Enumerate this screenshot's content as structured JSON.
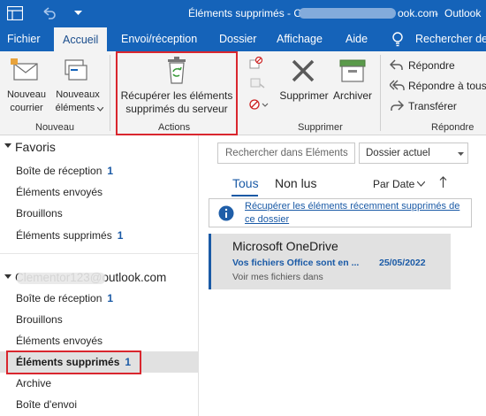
{
  "titlebar": {
    "title": "Éléments supprimés - C",
    "email_suffix": "ook.com",
    "app": "Outlook"
  },
  "tabs": [
    {
      "label": "Fichier"
    },
    {
      "label": "Accueil"
    },
    {
      "label": "Envoi/réception"
    },
    {
      "label": "Dossier"
    },
    {
      "label": "Affichage"
    },
    {
      "label": "Aide"
    }
  ],
  "search_tab": {
    "label": "Rechercher des"
  },
  "ribbon": {
    "new_mail": {
      "line1": "Nouveau",
      "line2": "courrier"
    },
    "new_items": {
      "line1": "Nouveaux",
      "line2": "éléments"
    },
    "group_new": "Nouveau",
    "recover": {
      "line1": "Récupérer les éléments",
      "line2": "supprimés du serveur"
    },
    "group_actions": "Actions",
    "delete": "Supprimer",
    "archive": "Archiver",
    "group_delete": "Supprimer",
    "reply": "Répondre",
    "reply_all": "Répondre à tous",
    "forward": "Transférer",
    "group_reply": "Répondre"
  },
  "folders": {
    "favorites_header": "Favoris",
    "favorites": [
      {
        "label": "Boîte de réception",
        "count": "1"
      },
      {
        "label": "Éléments envoyés",
        "count": ""
      },
      {
        "label": "Brouillons",
        "count": ""
      },
      {
        "label": "Éléments supprimés",
        "count": "1"
      }
    ],
    "account_header": "Clementor123@outlook.com",
    "account": [
      {
        "label": "Boîte de réception",
        "count": "1"
      },
      {
        "label": "Brouillons",
        "count": ""
      },
      {
        "label": "Éléments envoyés",
        "count": ""
      },
      {
        "label": "Éléments supprimés",
        "count": "1"
      },
      {
        "label": "Archive",
        "count": ""
      },
      {
        "label": "Boîte d'envoi",
        "count": ""
      }
    ]
  },
  "messages": {
    "search_placeholder": "Rechercher dans Éléments s",
    "scope": "Dossier actuel",
    "filter_all": "Tous",
    "filter_unread": "Non lus",
    "sort": "Par Date",
    "info_banner": "Récupérer les éléments récemment supprimés de ce dossier",
    "info_line1": "Récupérer les éléments récemment supprimés de",
    "info_line2": "ce dossier",
    "items": [
      {
        "sender": "Microsoft OneDrive",
        "subject": "Vos fichiers Office sont en ...",
        "date": "25/05/2022",
        "preview": "Voir mes fichiers dans"
      }
    ]
  },
  "colors": {
    "accent": "#1563b9",
    "highlight_box": "#d9262e",
    "selected_item": "#e1e1e1"
  }
}
